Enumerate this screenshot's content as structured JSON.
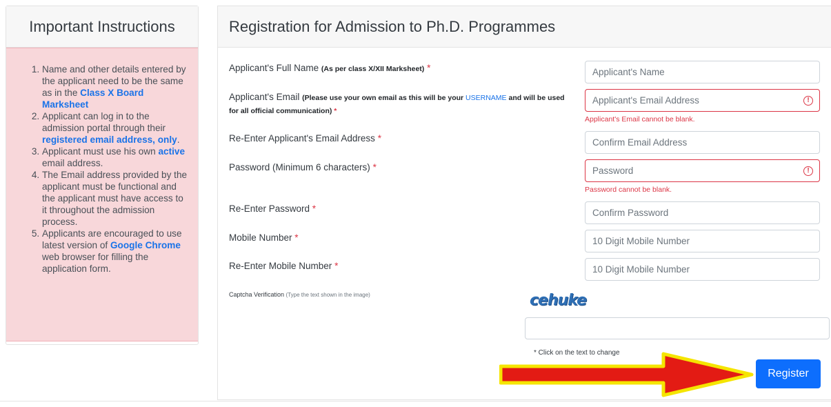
{
  "instructions": {
    "title": "Important Instructions",
    "items": [
      {
        "pre": "Name and other details entered by the applicant need to be the same as in the ",
        "hl": "Class X Board Marksheet",
        "post": ""
      },
      {
        "pre": "Applicant can log in to the admission portal through their ",
        "hl": "registered email address, only",
        "post": "."
      },
      {
        "pre": "Applicant must use his own ",
        "hl": "active",
        "post": " email address."
      },
      {
        "pre": "The Email address provided by the applicant must be functional and the applicant must have access to it throughout the admission process.",
        "hl": "",
        "post": ""
      },
      {
        "pre": "Applicants are encouraged to use latest version of ",
        "hl": "Google Chrome",
        "post": " web browser for filling the application form."
      }
    ]
  },
  "form": {
    "title": "Registration for Admission to Ph.D. Programmes",
    "full_name": {
      "label": "Applicant's Full Name ",
      "note": "(As per class X/XII Marksheet)",
      "req": "*",
      "placeholder": "Applicant's Name"
    },
    "email": {
      "label": "Applicant's Email ",
      "note_pre": "(Please use your own email as this will be your ",
      "note_user": "USERNAME",
      "note_post": " and will be used",
      "note_line2": "for all official communication)",
      "req": "*",
      "placeholder": "Applicant's Email Address",
      "error": "Applicant's Email cannot be blank."
    },
    "confirm_email": {
      "label": "Re-Enter Applicant's Email Address ",
      "req": "*",
      "placeholder": "Confirm Email Address"
    },
    "password": {
      "label": "Password (Minimum 6 characters) ",
      "req": "*",
      "placeholder": "Password",
      "error": "Password cannot be blank."
    },
    "confirm_password": {
      "label": "Re-Enter Password ",
      "req": "*",
      "placeholder": "Confirm Password"
    },
    "mobile": {
      "label": "Mobile Number ",
      "req": "*",
      "placeholder": "10 Digit Mobile Number"
    },
    "confirm_mobile": {
      "label": "Re-Enter Mobile Number ",
      "req": "*",
      "placeholder": "10 Digit Mobile Number"
    },
    "captcha": {
      "label": "Captcha Verification ",
      "note": "(Type the text shown in the image)",
      "image_text": "cehuke",
      "hint": "* Click on the text to change"
    },
    "register_label": "Register"
  },
  "colors": {
    "accent": "#0d6efd",
    "error": "#dc3545",
    "instructions_bg": "#f8d7da",
    "arrow": "#e31b14",
    "arrow_outline": "#f5e500"
  },
  "icons": {
    "error": "exclamation-circle-icon",
    "annotation": "red-arrow-icon"
  }
}
